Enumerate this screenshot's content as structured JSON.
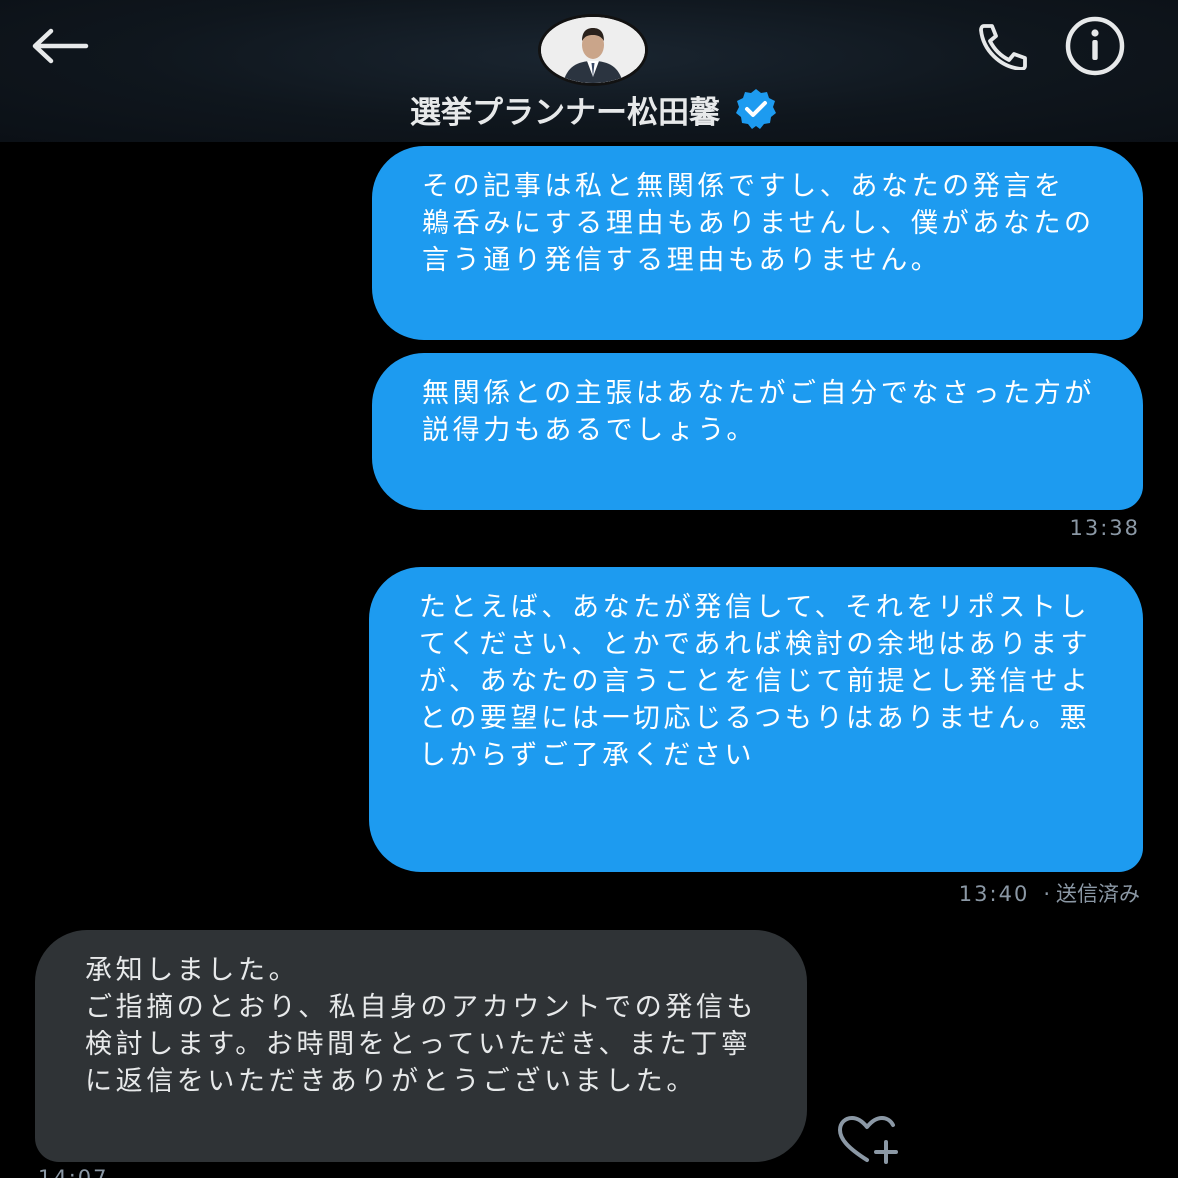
{
  "header": {
    "back_icon": "arrow-left-icon",
    "call_icon": "phone-icon",
    "info_icon": "info-icon",
    "display_name": "選挙プランナー松田馨",
    "verified_icon": "verified-badge-icon",
    "verified_color": "#1d9bf0"
  },
  "messages": [
    {
      "direction": "sent",
      "text": "その記事は私と無関係ですし、あなたの発言を鵜呑みにする理由もありませんし、僕があなたの言う通り発信する理由もありません。"
    },
    {
      "direction": "sent",
      "text": "無関係との主張はあなたがご自分でなさった方が説得力もあるでしょう。"
    },
    {
      "direction": "sent",
      "text": "たとえば、あなたが発信して、それをリポストしてください、とかであれば検討の余地はありますが、あなたの言うことを信じて前提とし発信せよとの要望には一切応じるつもりはありません。悪しからずご了承ください"
    },
    {
      "direction": "received",
      "text": "承知しました。\nご指摘のとおり、私自身のアカウントでの発信も検討します。お時間をとっていただき、また丁寧に返信をいただきありがとうございました。"
    }
  ],
  "timestamps": {
    "first_group": "13:38",
    "second_group_time": "13:40",
    "second_group_sep": "·",
    "second_group_status": "送信済み",
    "received": "14:07"
  },
  "reaction_icon": "heart-plus-icon",
  "colors": {
    "sent_bubble": "#1d9bf0",
    "received_bubble": "#2f3336",
    "background": "#000000",
    "muted_text": "#8b98a5"
  }
}
